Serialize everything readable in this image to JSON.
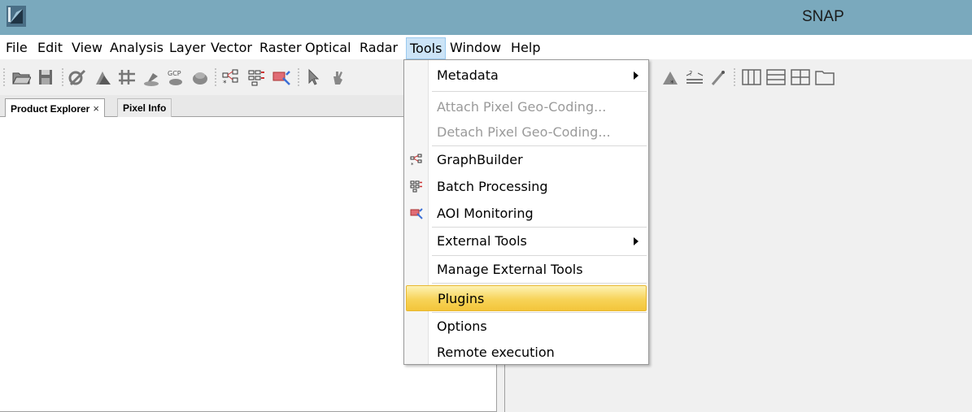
{
  "window": {
    "title": "SNAP"
  },
  "menubar": {
    "items": [
      {
        "label": "File"
      },
      {
        "label": "Edit"
      },
      {
        "label": "View"
      },
      {
        "label": "Analysis"
      },
      {
        "label": "Layer"
      },
      {
        "label": "Vector"
      },
      {
        "label": "Raster"
      },
      {
        "label": "Optical"
      },
      {
        "label": "Radar"
      },
      {
        "label": "Tools"
      },
      {
        "label": "Window"
      },
      {
        "label": "Help"
      }
    ],
    "active": "Tools"
  },
  "tabs": {
    "product_explorer": "Product Explorer",
    "close_glyph": "×",
    "pixel_info": "Pixel Info"
  },
  "tools_menu": {
    "items": [
      {
        "label": "Metadata",
        "enabled": true,
        "submenu": true
      },
      {
        "label": "Attach Pixel Geo-Coding...",
        "enabled": false
      },
      {
        "label": "Detach Pixel Geo-Coding...",
        "enabled": false
      },
      {
        "label": "GraphBuilder",
        "enabled": true,
        "icon": "graph-builder-icon"
      },
      {
        "label": "Batch Processing",
        "enabled": true,
        "icon": "batch-processing-icon"
      },
      {
        "label": "AOI Monitoring",
        "enabled": true,
        "icon": "aoi-monitoring-icon"
      },
      {
        "label": "External Tools",
        "enabled": true,
        "submenu": true
      },
      {
        "label": "Manage External Tools",
        "enabled": true
      },
      {
        "label": "Plugins",
        "enabled": true,
        "highlighted": true
      },
      {
        "label": "Options",
        "enabled": true
      },
      {
        "label": "Remote execution",
        "enabled": true
      }
    ]
  },
  "colors": {
    "titlebar": "#7aa9bd",
    "menu_highlight": "#f7d358",
    "active_menu": "#cce4f7"
  }
}
